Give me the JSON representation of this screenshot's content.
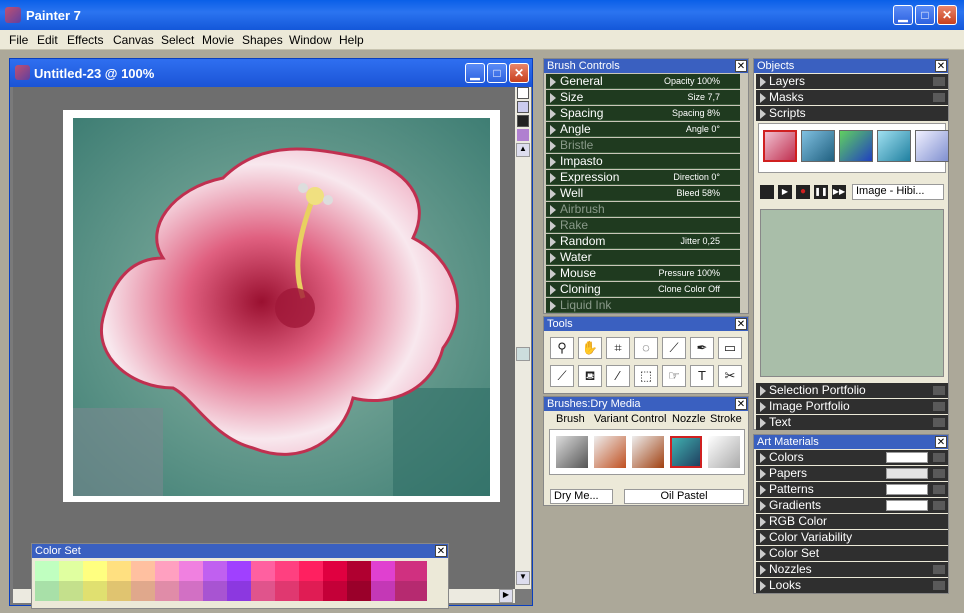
{
  "app": {
    "title": "Painter 7"
  },
  "menu": [
    "File",
    "Edit",
    "Effects",
    "Canvas",
    "Select",
    "Movie",
    "Shapes",
    "Window",
    "Help"
  ],
  "document": {
    "title": "Untitled-23 @ 100%"
  },
  "brush_controls": {
    "title": "Brush Controls",
    "rows": [
      {
        "name": "General",
        "value": "Opacity 100%",
        "enabled": true
      },
      {
        "name": "Size",
        "value": "Size 7,7",
        "enabled": true
      },
      {
        "name": "Spacing",
        "value": "Spacing 8%",
        "enabled": true
      },
      {
        "name": "Angle",
        "value": "Angle 0°",
        "enabled": true
      },
      {
        "name": "Bristle",
        "value": "",
        "enabled": false
      },
      {
        "name": "Impasto",
        "value": "",
        "enabled": true
      },
      {
        "name": "Expression",
        "value": "Direction 0°",
        "enabled": true
      },
      {
        "name": "Well",
        "value": "Bleed 58%",
        "enabled": true
      },
      {
        "name": "Airbrush",
        "value": "",
        "enabled": false
      },
      {
        "name": "Rake",
        "value": "",
        "enabled": false
      },
      {
        "name": "Random",
        "value": "Jitter 0,25",
        "enabled": true
      },
      {
        "name": "Water",
        "value": "",
        "enabled": true
      },
      {
        "name": "Mouse",
        "value": "Pressure 100%",
        "enabled": true
      },
      {
        "name": "Cloning",
        "value": "Clone Color Off",
        "enabled": true
      },
      {
        "name": "Liquid Ink",
        "value": "",
        "enabled": false
      }
    ]
  },
  "tools": {
    "title": "Tools",
    "items": [
      {
        "name": "magnifier-icon",
        "glyph": "⚲"
      },
      {
        "name": "grabber-icon",
        "glyph": "✋"
      },
      {
        "name": "crop-icon",
        "glyph": "⌗"
      },
      {
        "name": "lasso-icon",
        "glyph": "◌"
      },
      {
        "name": "brush-icon",
        "glyph": "⟋"
      },
      {
        "name": "pen-icon",
        "glyph": "✒"
      },
      {
        "name": "rectangle-icon",
        "glyph": "▭"
      },
      {
        "name": "dropper-brush-icon",
        "glyph": "⟋"
      },
      {
        "name": "paint-bucket-icon",
        "glyph": "⛾"
      },
      {
        "name": "dropper-icon",
        "glyph": "⁄"
      },
      {
        "name": "rect-select-icon",
        "glyph": "⬚"
      },
      {
        "name": "layer-adjuster-icon",
        "glyph": "☞"
      },
      {
        "name": "text-icon",
        "glyph": "T"
      },
      {
        "name": "scissors-icon",
        "glyph": "✂"
      }
    ]
  },
  "brushes": {
    "title": "Brushes:Dry Media",
    "tabs": [
      "Brush",
      "Variant",
      "Control",
      "Nozzle",
      "Stroke"
    ],
    "category": "Dry Me...",
    "variant": "Oil Pastel"
  },
  "objects": {
    "title": "Objects",
    "sections": [
      "Layers",
      "Masks",
      "Scripts"
    ],
    "script_name": "Image - Hibi...",
    "more_sections": [
      "Selection Portfolio",
      "Image Portfolio",
      "Text"
    ]
  },
  "art_materials": {
    "title": "Art Materials",
    "rows": [
      "Colors",
      "Papers",
      "Patterns",
      "Gradients",
      "RGB Color",
      "Color Variability",
      "Color Set",
      "Nozzles",
      "Looks"
    ]
  },
  "color_set": {
    "title": "Color Set"
  },
  "colors": {
    "titlebar": "#0a5fe8",
    "panel_header": "#3a60c0",
    "brush_row": "#1f3a1f"
  }
}
